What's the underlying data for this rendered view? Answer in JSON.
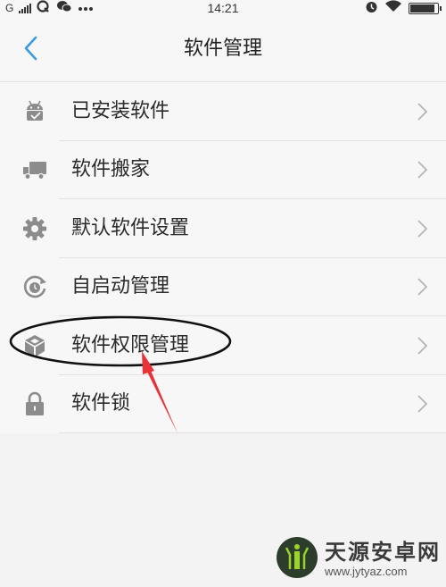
{
  "status_bar": {
    "carrier": "G",
    "time": "14:21",
    "icons": [
      "signal-icon",
      "q-app-icon",
      "wechat-icon",
      "more-dots-icon",
      "alarm-icon",
      "wifi-icon",
      "battery-icon"
    ],
    "battery_level": 0.9
  },
  "nav": {
    "back_icon": "chevron-left-icon",
    "title": "软件管理"
  },
  "menu": {
    "items": [
      {
        "label": "已安装软件",
        "icon": "android-check-icon"
      },
      {
        "label": "软件搬家",
        "icon": "truck-icon"
      },
      {
        "label": "默认软件设置",
        "icon": "gear-icon"
      },
      {
        "label": "自启动管理",
        "icon": "auto-start-icon"
      },
      {
        "label": "软件权限管理",
        "icon": "cube-permission-icon"
      },
      {
        "label": "软件锁",
        "icon": "lock-icon"
      }
    ],
    "chevron_icon": "chevron-right-icon"
  },
  "annotation": {
    "highlighted_item": "软件权限管理",
    "color": "#111111",
    "arrow_color": "#e8323a"
  },
  "watermark": {
    "title": "天源安卓网",
    "url": "www.jytyaz.com"
  },
  "colors": {
    "accent": "#3a9be0",
    "icon_gray": "#8c8c8c",
    "background": "#f7f7f7"
  }
}
